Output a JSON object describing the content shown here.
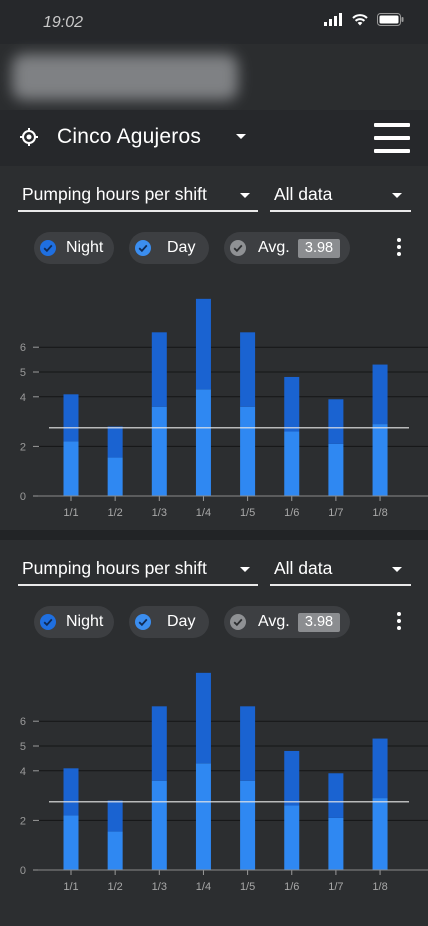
{
  "status_bar": {
    "time": "19:02"
  },
  "header": {
    "location": "Cinco Agujeros"
  },
  "colors": {
    "night": "#1a63d1",
    "day": "#2f88f2",
    "avg": "#e8e8e8",
    "background": "#2c2e30"
  },
  "icons": {
    "signal": "signal-icon",
    "wifi": "wifi-icon",
    "battery": "battery-icon",
    "location": "location-target-icon",
    "menu": "hamburger-menu-icon",
    "dropdown": "chevron-down-icon",
    "check": "check-circle-icon",
    "more": "more-vertical-icon"
  },
  "panels": [
    {
      "metric_select": "Pumping hours per shift",
      "range_select": "All data",
      "chips": {
        "night": "Night",
        "day": "Day",
        "avg": "Avg.",
        "avg_value": "3.98"
      }
    },
    {
      "metric_select": "Pumping hours per shift",
      "range_select": "All data",
      "chips": {
        "night": "Night",
        "day": "Day",
        "avg": "Avg.",
        "avg_value": "3.98"
      }
    }
  ],
  "chart_data": [
    {
      "type": "bar",
      "stacked": true,
      "categories": [
        "1/1",
        "1/2",
        "1/3",
        "1/4",
        "1/5",
        "1/6",
        "1/7",
        "1/8"
      ],
      "series": [
        {
          "name": "Day",
          "values": [
            2.2,
            1.55,
            3.6,
            4.3,
            3.6,
            2.6,
            2.1,
            2.9
          ]
        },
        {
          "name": "Night",
          "values": [
            1.9,
            1.25,
            3.0,
            3.65,
            3.0,
            2.2,
            1.8,
            2.4
          ]
        }
      ],
      "avg_line": 2.75,
      "y_ticks": [
        {
          "value": 0,
          "label": "0"
        },
        {
          "value": 2,
          "label": "2"
        },
        {
          "value": 4,
          "label": "4"
        },
        {
          "value": 5,
          "label": "5"
        },
        {
          "value": 6,
          "label": "6"
        }
      ],
      "grid": true
    },
    {
      "type": "bar",
      "stacked": true,
      "categories": [
        "1/1",
        "1/2",
        "1/3",
        "1/4",
        "1/5",
        "1/6",
        "1/7",
        "1/8"
      ],
      "series": [
        {
          "name": "Day",
          "values": [
            2.2,
            1.55,
            3.6,
            4.3,
            3.6,
            2.6,
            2.1,
            2.9
          ]
        },
        {
          "name": "Night",
          "values": [
            1.9,
            1.25,
            3.0,
            3.65,
            3.0,
            2.2,
            1.8,
            2.4
          ]
        }
      ],
      "avg_line": 2.75,
      "y_ticks": [
        {
          "value": 0,
          "label": "0"
        },
        {
          "value": 2,
          "label": "2"
        },
        {
          "value": 4,
          "label": "4"
        },
        {
          "value": 5,
          "label": "5"
        },
        {
          "value": 6,
          "label": "6"
        }
      ],
      "grid": true
    }
  ]
}
